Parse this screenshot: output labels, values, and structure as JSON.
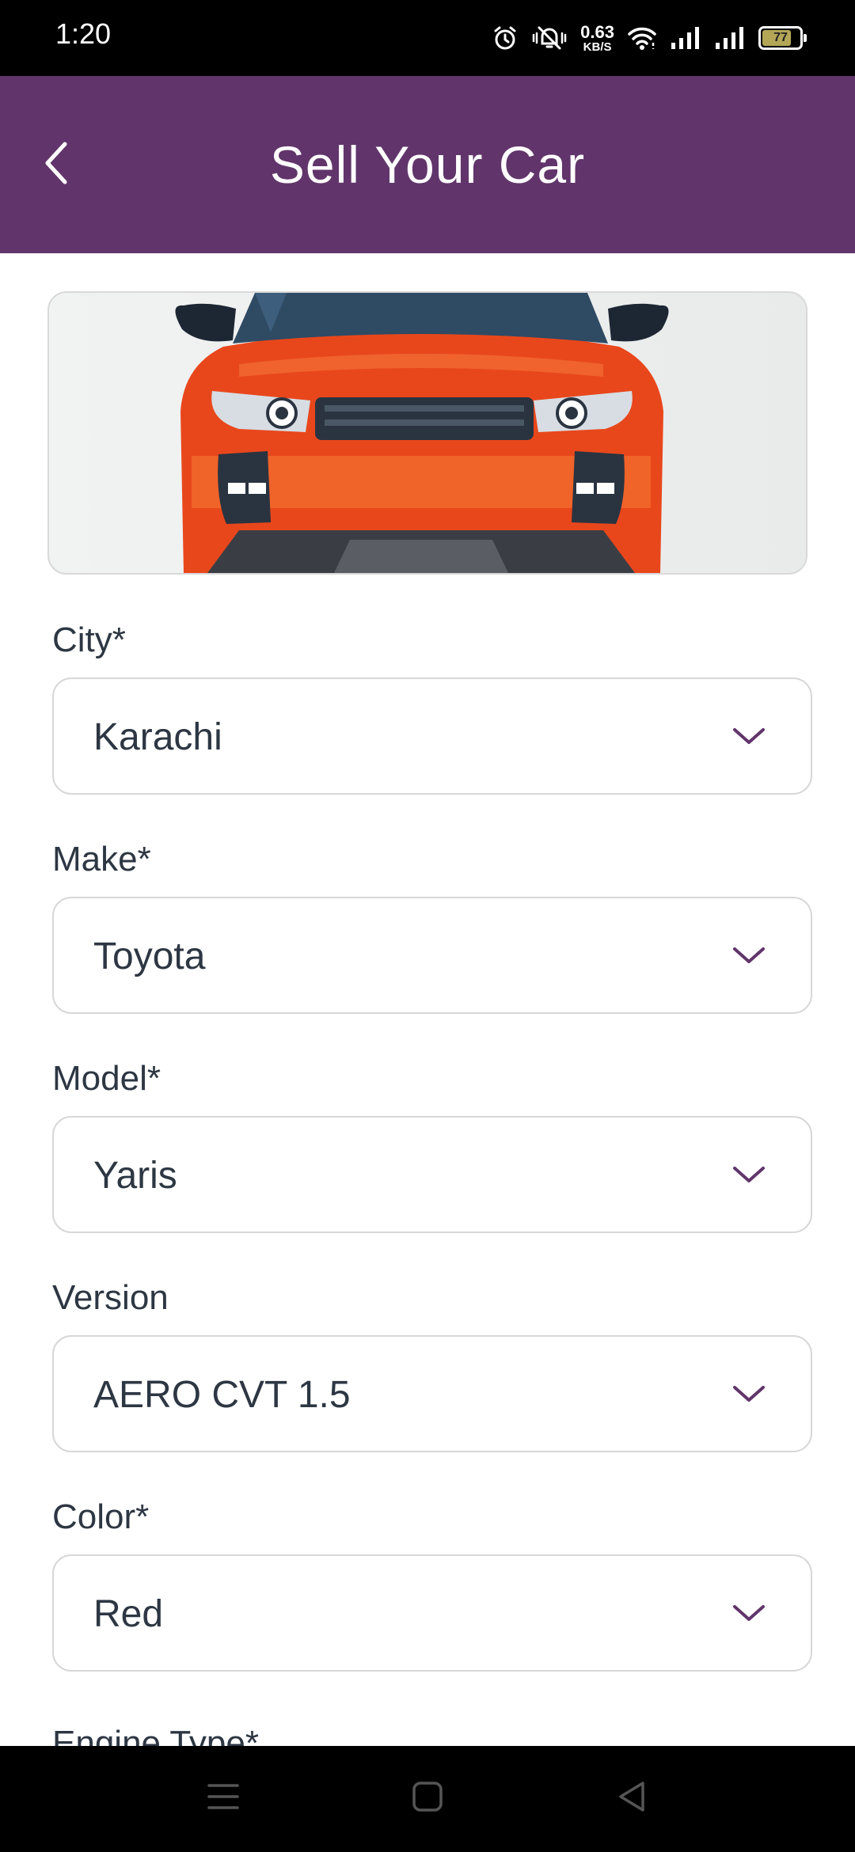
{
  "status_bar": {
    "time": "1:20",
    "net_speed_value": "0.63",
    "net_speed_unit": "KB/S",
    "battery_level": "77",
    "icons": [
      "alarm-icon",
      "mute-icon",
      "wifi-icon",
      "signal-icon",
      "signal-icon",
      "battery-icon"
    ]
  },
  "app_bar": {
    "title": "Sell Your Car",
    "back_icon": "chevron-left-icon",
    "color": "#61356b"
  },
  "form": {
    "fields": [
      {
        "label": "City*",
        "value": "Karachi"
      },
      {
        "label": "Make*",
        "value": "Toyota"
      },
      {
        "label": "Model*",
        "value": "Yaris"
      },
      {
        "label": "Version",
        "value": "AERO CVT 1.5"
      },
      {
        "label": "Color*",
        "value": "Red"
      }
    ],
    "next_label_partial": "Engine Type*",
    "dropdown_icon": "chevron-down-icon",
    "accent": "#61356b"
  },
  "nav_bar": {
    "icons": [
      "menu-icon",
      "home-icon",
      "back-triangle-icon"
    ]
  }
}
